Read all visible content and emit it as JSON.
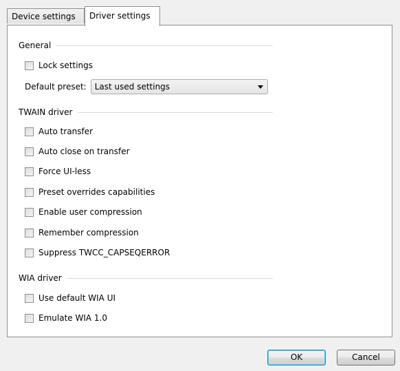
{
  "tabs": [
    {
      "label": "Device settings",
      "active": false
    },
    {
      "label": "Driver settings",
      "active": true
    }
  ],
  "general": {
    "header": "General",
    "lock_settings": {
      "label": "Lock settings",
      "checked": false
    },
    "default_preset": {
      "label": "Default preset:",
      "value": "Last used settings"
    }
  },
  "twain": {
    "header": "TWAIN driver",
    "items": [
      {
        "label": "Auto transfer",
        "checked": false
      },
      {
        "label": "Auto close on transfer",
        "checked": false
      },
      {
        "label": "Force UI-less",
        "checked": false
      },
      {
        "label": "Preset overrides capabilities",
        "checked": false
      },
      {
        "label": "Enable user compression",
        "checked": false
      },
      {
        "label": "Remember compression",
        "checked": false
      },
      {
        "label": "Suppress TWCC_CAPSEQERROR",
        "checked": false
      }
    ]
  },
  "wia": {
    "header": "WIA driver",
    "items": [
      {
        "label": "Use default WIA UI",
        "checked": false
      },
      {
        "label": "Emulate WIA 1.0",
        "checked": false
      }
    ]
  },
  "buttons": {
    "ok": "OK",
    "cancel": "Cancel"
  }
}
